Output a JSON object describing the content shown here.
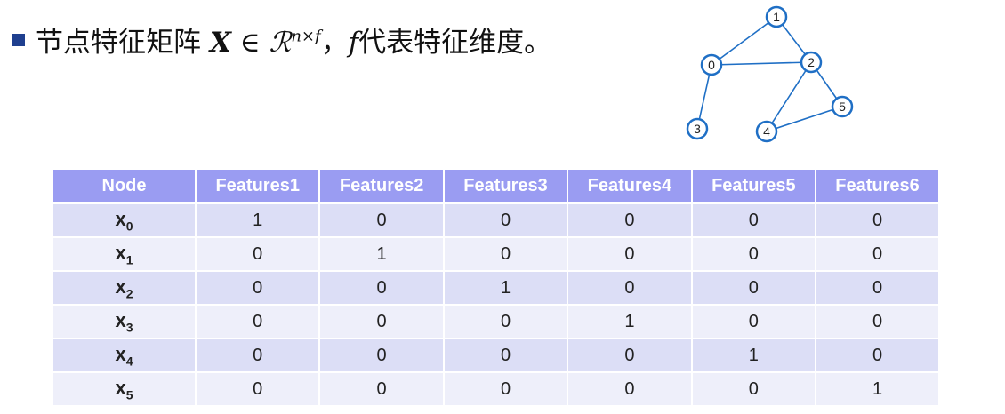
{
  "slide": {
    "title_prefix": "节点特征矩阵 ",
    "title_symbol": "X",
    "title_in": " ∈ ",
    "title_space": "ℛ",
    "title_sup": "n×f",
    "title_sep": "，",
    "title_f": "f",
    "title_suffix": "代表特征维度。"
  },
  "graph": {
    "color": "#1f6fc5",
    "nodes": [
      "0",
      "1",
      "2",
      "3",
      "4",
      "5"
    ],
    "edges": [
      [
        "0",
        "1"
      ],
      [
        "1",
        "2"
      ],
      [
        "0",
        "2"
      ],
      [
        "0",
        "3"
      ],
      [
        "2",
        "4"
      ],
      [
        "2",
        "5"
      ],
      [
        "4",
        "5"
      ]
    ]
  },
  "table": {
    "headers": [
      "Node",
      "Features1",
      "Features2",
      "Features3",
      "Features4",
      "Features5",
      "Features6"
    ],
    "rows": [
      {
        "node": "x",
        "sub": "0",
        "values": [
          "1",
          "0",
          "0",
          "0",
          "0",
          "0"
        ]
      },
      {
        "node": "x",
        "sub": "1",
        "values": [
          "0",
          "1",
          "0",
          "0",
          "0",
          "0"
        ]
      },
      {
        "node": "x",
        "sub": "2",
        "values": [
          "0",
          "0",
          "1",
          "0",
          "0",
          "0"
        ]
      },
      {
        "node": "x",
        "sub": "3",
        "values": [
          "0",
          "0",
          "0",
          "1",
          "0",
          "0"
        ]
      },
      {
        "node": "x",
        "sub": "4",
        "values": [
          "0",
          "0",
          "0",
          "0",
          "1",
          "0"
        ]
      },
      {
        "node": "x",
        "sub": "5",
        "values": [
          "0",
          "0",
          "0",
          "0",
          "0",
          "1"
        ]
      }
    ],
    "colors": {
      "header": "#9a9cf2",
      "row_odd": "#dcdef6",
      "row_even": "#eeeffa"
    }
  }
}
